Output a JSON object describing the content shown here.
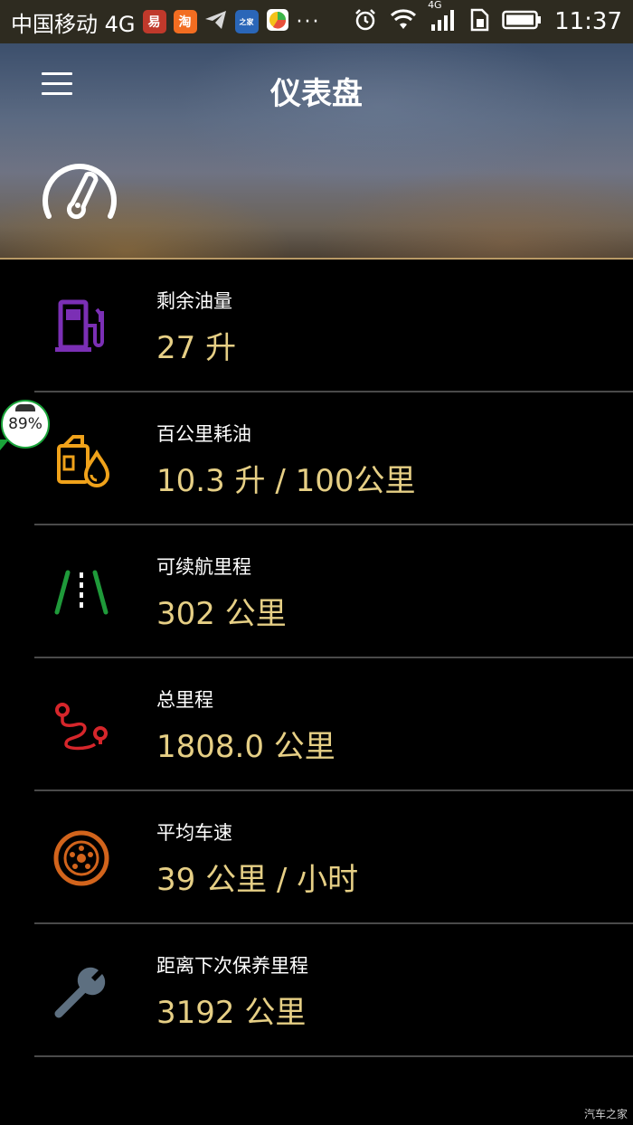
{
  "status_bar": {
    "carrier": "中国移动 4G",
    "time": "11:37",
    "network": "4G",
    "app_icons": [
      {
        "name": "netease-news-app-icon",
        "color": "#c0392b"
      },
      {
        "name": "taobao-app-icon",
        "color": "#f26d21"
      },
      {
        "name": "telegram-app-icon",
        "color": "#d8d8d8"
      },
      {
        "name": "autohome-app-icon",
        "color": "#2a66b8"
      },
      {
        "name": "colorful-app-icon",
        "color": "#3bb54a"
      }
    ],
    "more": "···"
  },
  "header": {
    "title": "仪表盘"
  },
  "items": [
    {
      "label": "剩余油量",
      "value": "27 升",
      "icon": "fuel-pump-icon",
      "color": "#7b2fb5"
    },
    {
      "label": "百公里耗油",
      "value": "10.3 升 / 100公里",
      "icon": "oil-can-drop-icon",
      "color": "#f0a21a"
    },
    {
      "label": "可续航里程",
      "value": "302 公里",
      "icon": "road-lanes-icon",
      "color": "#1f9a3a"
    },
    {
      "label": "总里程",
      "value": "1808.0 公里",
      "icon": "route-icon",
      "color": "#d6262b"
    },
    {
      "label": "平均车速",
      "value": "39 公里 / 小时",
      "icon": "tire-icon",
      "color": "#d2641c"
    },
    {
      "label": "距离下次保养里程",
      "value": "3192 公里",
      "icon": "wrench-icon",
      "color": "#5d6f80"
    }
  ],
  "floating_badge": {
    "text": "89%"
  },
  "watermark": "汽车之家",
  "colors": {
    "value": "#e6cf85",
    "divider": "#4a4a4a",
    "accent_line": "#b99a66"
  }
}
